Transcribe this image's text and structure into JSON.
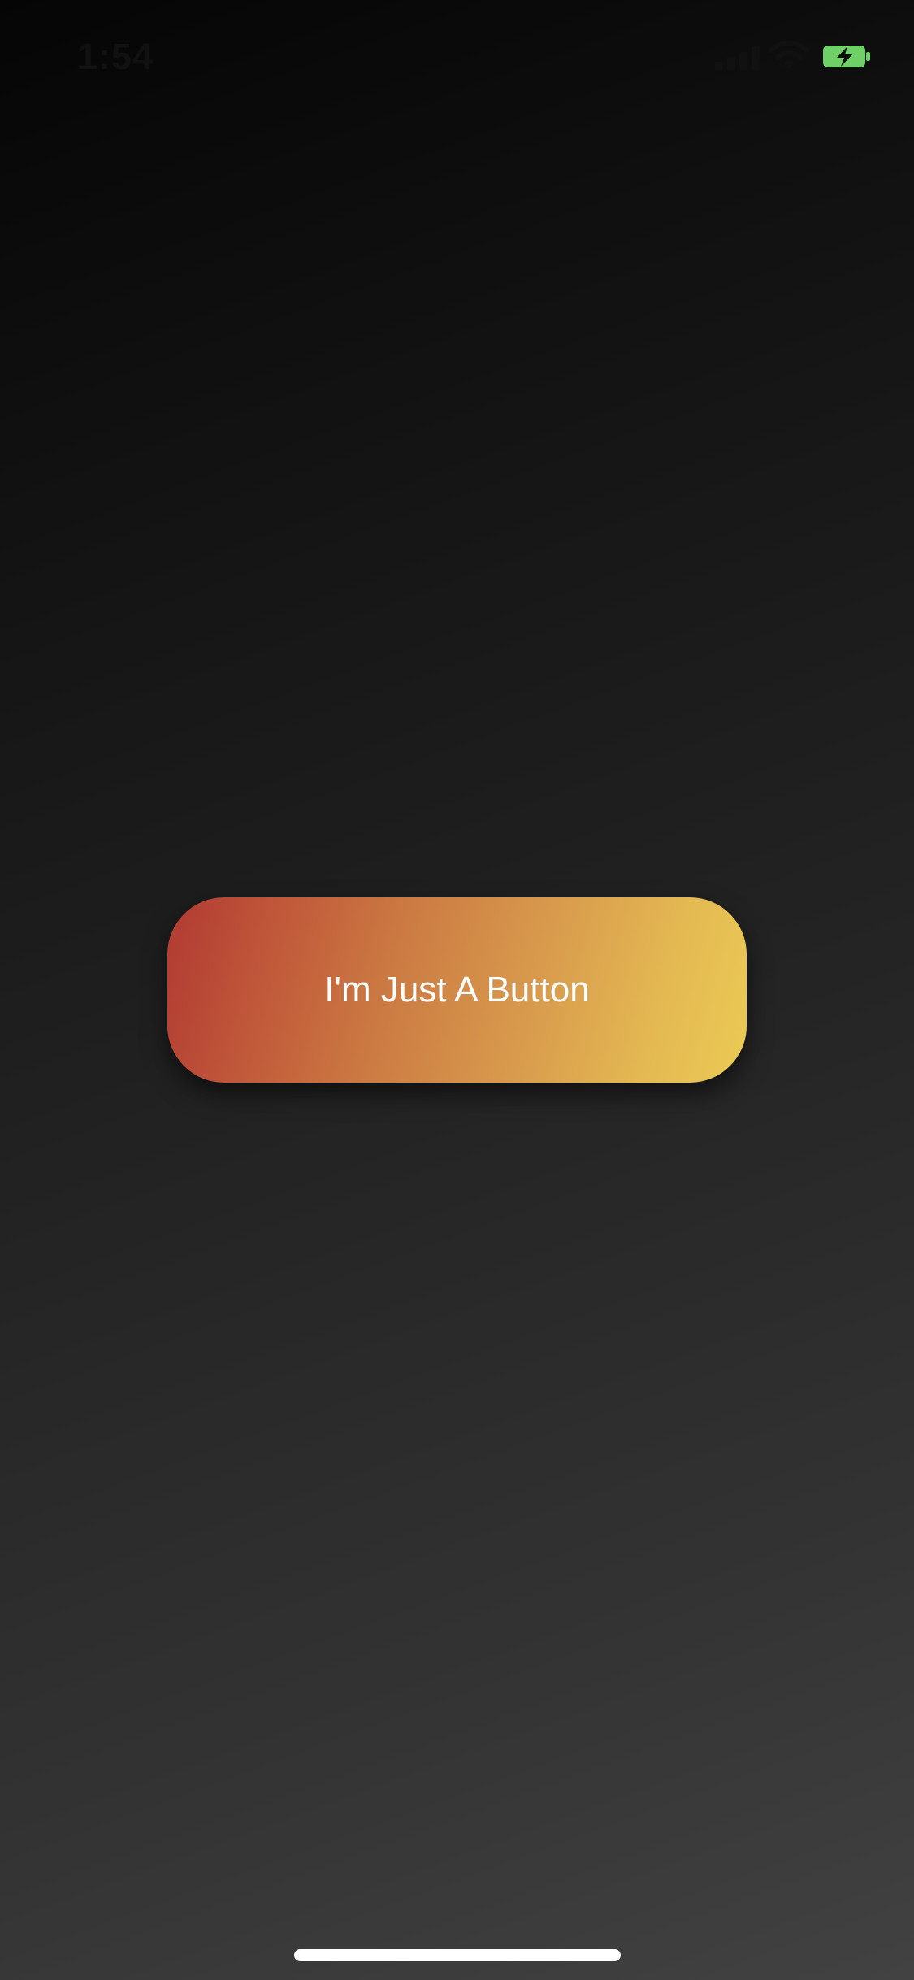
{
  "status_bar": {
    "time": "1:54",
    "icons": [
      "cellular-icon",
      "wifi-icon",
      "battery-charging-icon"
    ],
    "battery_color": "#6fd067"
  },
  "main": {
    "button_label": "I'm Just A Button",
    "button_gradient": [
      "#b13a33",
      "#ebcb55"
    ]
  },
  "background_gradient": [
    "#050505",
    "#424242"
  ]
}
